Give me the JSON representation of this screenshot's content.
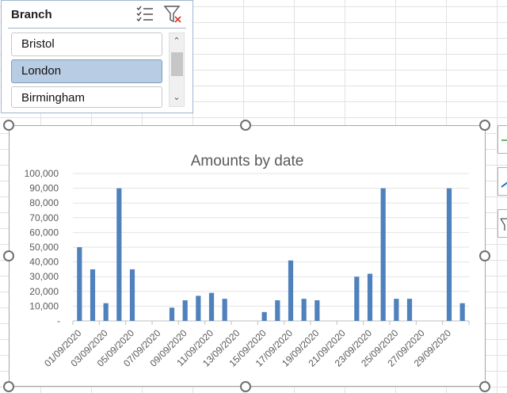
{
  "slicer": {
    "title": "Branch",
    "items": [
      {
        "label": "Bristol",
        "selected": false
      },
      {
        "label": "London",
        "selected": true
      },
      {
        "label": "Birmingham",
        "selected": false
      }
    ]
  },
  "chart_data": {
    "type": "bar",
    "title": "Amounts by date",
    "xlabel": "",
    "ylabel": "",
    "ylim": [
      0,
      100000
    ],
    "yticks": [
      "-",
      "10,000",
      "20,000",
      "30,000",
      "40,000",
      "50,000",
      "60,000",
      "70,000",
      "80,000",
      "90,000",
      "100,000"
    ],
    "categories": [
      "01/09/2020",
      "02/09/2020",
      "03/09/2020",
      "04/09/2020",
      "05/09/2020",
      "06/09/2020",
      "07/09/2020",
      "08/09/2020",
      "09/09/2020",
      "10/09/2020",
      "11/09/2020",
      "12/09/2020",
      "13/09/2020",
      "14/09/2020",
      "15/09/2020",
      "16/09/2020",
      "17/09/2020",
      "18/09/2020",
      "19/09/2020",
      "20/09/2020",
      "21/09/2020",
      "22/09/2020",
      "23/09/2020",
      "24/09/2020",
      "25/09/2020",
      "26/09/2020",
      "27/09/2020",
      "28/09/2020",
      "29/09/2020",
      "30/09/2020"
    ],
    "tick_labels": [
      "01/09/2020",
      "03/09/2020",
      "05/09/2020",
      "07/09/2020",
      "09/09/2020",
      "11/09/2020",
      "13/09/2020",
      "15/09/2020",
      "17/09/2020",
      "19/09/2020",
      "21/09/2020",
      "23/09/2020",
      "25/09/2020",
      "27/09/2020",
      "29/09/2020"
    ],
    "values": [
      50000,
      35000,
      12000,
      90000,
      35000,
      0,
      0,
      9000,
      14000,
      17000,
      19000,
      15000,
      0,
      0,
      6000,
      14000,
      41000,
      15000,
      14000,
      0,
      0,
      30000,
      32000,
      90000,
      15000,
      15000,
      0,
      0,
      90000,
      12000
    ],
    "bar_color": "#4f81bd",
    "grid": true
  }
}
